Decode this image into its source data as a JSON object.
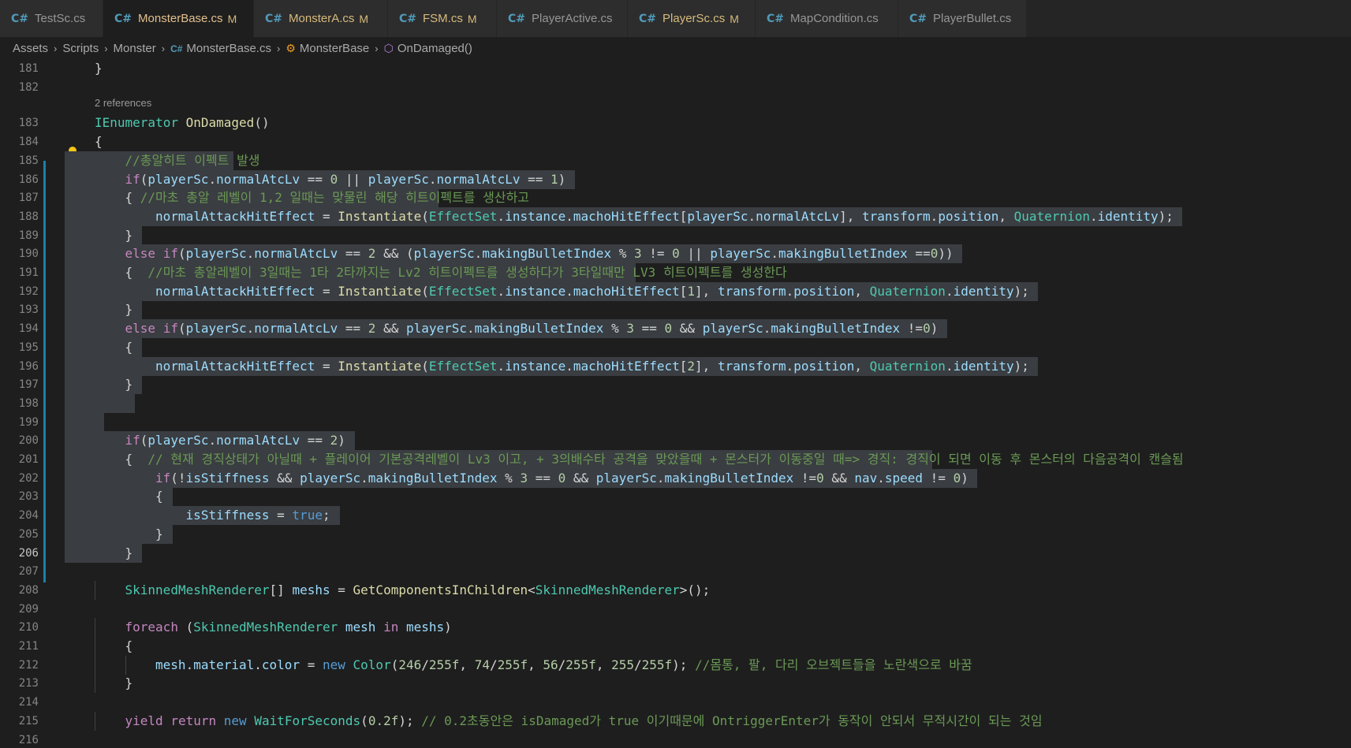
{
  "tabs": [
    {
      "label": "TestSc.cs",
      "status": "",
      "active": false,
      "dirty": false
    },
    {
      "label": "MonsterBase.cs",
      "status": "M",
      "active": true,
      "dirty": true
    },
    {
      "label": "MonsterA.cs",
      "status": "M",
      "active": false,
      "dirty": false
    },
    {
      "label": "FSM.cs",
      "status": "M",
      "active": false,
      "dirty": false
    },
    {
      "label": "PlayerActive.cs",
      "status": "",
      "active": false,
      "dirty": false
    },
    {
      "label": "PlayerSc.cs",
      "status": "M",
      "active": false,
      "dirty": false
    },
    {
      "label": "MapCondition.cs",
      "status": "",
      "active": false,
      "dirty": false
    },
    {
      "label": "PlayerBullet.cs",
      "status": "",
      "active": false,
      "dirty": false
    }
  ],
  "tab_icon_glyph": "C#",
  "breadcrumb": [
    {
      "label": "Assets",
      "icon": ""
    },
    {
      "label": "Scripts",
      "icon": ""
    },
    {
      "label": "Monster",
      "icon": ""
    },
    {
      "label": "MonsterBase.cs",
      "icon": "csharp-file-icon"
    },
    {
      "label": "MonsterBase",
      "icon": "class-icon"
    },
    {
      "label": "OnDamaged()",
      "icon": "method-icon"
    }
  ],
  "codelens": "2 references",
  "current_line": 206,
  "colors": {
    "background": "#1e1e1e",
    "tab_bar": "#252526",
    "selection": "#3a3d41",
    "keyword": "#569cd6",
    "control": "#c586c0",
    "type": "#4ec9b0",
    "function": "#dcdcaa",
    "variable": "#9cdcfe",
    "number": "#b5cea8",
    "comment": "#6a9955",
    "modified_bar": "#1b81a8"
  },
  "lines": [
    {
      "n": 181,
      "indent": 0,
      "sel": false,
      "tokens": [
        [
          "pl",
          "}"
        ]
      ]
    },
    {
      "n": 182,
      "indent": 0,
      "sel": false,
      "tokens": []
    },
    {
      "n": 183,
      "indent": 0,
      "sel": false,
      "tokens": [
        [
          "ty",
          "IEnumerator"
        ],
        [
          "pl",
          " "
        ],
        [
          "fn",
          "OnDamaged"
        ],
        [
          "pl",
          "()"
        ]
      ]
    },
    {
      "n": 184,
      "indent": 0,
      "sel": false,
      "tokens": [
        [
          "pl",
          "{"
        ]
      ]
    },
    {
      "n": 185,
      "indent": 1,
      "sel": true,
      "tokens": [
        [
          "cm",
          "//총알히트 이펙트 발생"
        ]
      ]
    },
    {
      "n": 186,
      "indent": 1,
      "sel": true,
      "tokens": [
        [
          "ctl",
          "if"
        ],
        [
          "pl",
          "("
        ],
        [
          "var",
          "playerSc"
        ],
        [
          "pl",
          "."
        ],
        [
          "var",
          "normalAtcLv"
        ],
        [
          "pl",
          " == "
        ],
        [
          "num",
          "0"
        ],
        [
          "pl",
          " || "
        ],
        [
          "var",
          "playerSc"
        ],
        [
          "pl",
          "."
        ],
        [
          "var",
          "normalAtcLv"
        ],
        [
          "pl",
          " == "
        ],
        [
          "num",
          "1"
        ],
        [
          "pl",
          ")"
        ]
      ]
    },
    {
      "n": 187,
      "indent": 1,
      "sel": true,
      "tokens": [
        [
          "pl",
          "{ "
        ],
        [
          "cm",
          "//마초 총알 레벨이 1,2 일때는 맞물린 해당 히트이펙트를 생산하고"
        ]
      ]
    },
    {
      "n": 188,
      "indent": 2,
      "sel": true,
      "tokens": [
        [
          "var",
          "normalAttackHitEffect"
        ],
        [
          "pl",
          " = "
        ],
        [
          "fn",
          "Instantiate"
        ],
        [
          "pl",
          "("
        ],
        [
          "ty",
          "EffectSet"
        ],
        [
          "pl",
          "."
        ],
        [
          "var",
          "instance"
        ],
        [
          "pl",
          "."
        ],
        [
          "var",
          "machoHitEffect"
        ],
        [
          "pl",
          "["
        ],
        [
          "var",
          "playerSc"
        ],
        [
          "pl",
          "."
        ],
        [
          "var",
          "normalAtcLv"
        ],
        [
          "pl",
          "], "
        ],
        [
          "var",
          "transform"
        ],
        [
          "pl",
          "."
        ],
        [
          "var",
          "position"
        ],
        [
          "pl",
          ", "
        ],
        [
          "ty",
          "Quaternion"
        ],
        [
          "pl",
          "."
        ],
        [
          "var",
          "identity"
        ],
        [
          "pl",
          ");"
        ]
      ]
    },
    {
      "n": 189,
      "indent": 1,
      "sel": true,
      "tokens": [
        [
          "pl",
          "}"
        ]
      ]
    },
    {
      "n": 190,
      "indent": 1,
      "sel": true,
      "tokens": [
        [
          "ctl",
          "else"
        ],
        [
          "pl",
          " "
        ],
        [
          "ctl",
          "if"
        ],
        [
          "pl",
          "("
        ],
        [
          "var",
          "playerSc"
        ],
        [
          "pl",
          "."
        ],
        [
          "var",
          "normalAtcLv"
        ],
        [
          "pl",
          " == "
        ],
        [
          "num",
          "2"
        ],
        [
          "pl",
          " && ("
        ],
        [
          "var",
          "playerSc"
        ],
        [
          "pl",
          "."
        ],
        [
          "var",
          "makingBulletIndex"
        ],
        [
          "pl",
          " % "
        ],
        [
          "num",
          "3"
        ],
        [
          "pl",
          " != "
        ],
        [
          "num",
          "0"
        ],
        [
          "pl",
          " || "
        ],
        [
          "var",
          "playerSc"
        ],
        [
          "pl",
          "."
        ],
        [
          "var",
          "makingBulletIndex"
        ],
        [
          "pl",
          " =="
        ],
        [
          "num",
          "0"
        ],
        [
          "pl",
          "))"
        ]
      ]
    },
    {
      "n": 191,
      "indent": 1,
      "sel": true,
      "tokens": [
        [
          "pl",
          "{  "
        ],
        [
          "cm",
          "//마초 총알레벨이 3일때는 1타 2타까지는 Lv2 히트이펙트를 생성하다가 3타일때만 LV3 히트이펙트를 생성한다"
        ]
      ]
    },
    {
      "n": 192,
      "indent": 2,
      "sel": true,
      "tokens": [
        [
          "var",
          "normalAttackHitEffect"
        ],
        [
          "pl",
          " = "
        ],
        [
          "fn",
          "Instantiate"
        ],
        [
          "pl",
          "("
        ],
        [
          "ty",
          "EffectSet"
        ],
        [
          "pl",
          "."
        ],
        [
          "var",
          "instance"
        ],
        [
          "pl",
          "."
        ],
        [
          "var",
          "machoHitEffect"
        ],
        [
          "pl",
          "["
        ],
        [
          "num",
          "1"
        ],
        [
          "pl",
          "], "
        ],
        [
          "var",
          "transform"
        ],
        [
          "pl",
          "."
        ],
        [
          "var",
          "position"
        ],
        [
          "pl",
          ", "
        ],
        [
          "ty",
          "Quaternion"
        ],
        [
          "pl",
          "."
        ],
        [
          "var",
          "identity"
        ],
        [
          "pl",
          ");"
        ]
      ]
    },
    {
      "n": 193,
      "indent": 1,
      "sel": true,
      "tokens": [
        [
          "pl",
          "}"
        ]
      ]
    },
    {
      "n": 194,
      "indent": 1,
      "sel": true,
      "tokens": [
        [
          "ctl",
          "else"
        ],
        [
          "pl",
          " "
        ],
        [
          "ctl",
          "if"
        ],
        [
          "pl",
          "("
        ],
        [
          "var",
          "playerSc"
        ],
        [
          "pl",
          "."
        ],
        [
          "var",
          "normalAtcLv"
        ],
        [
          "pl",
          " == "
        ],
        [
          "num",
          "2"
        ],
        [
          "pl",
          " && "
        ],
        [
          "var",
          "playerSc"
        ],
        [
          "pl",
          "."
        ],
        [
          "var",
          "makingBulletIndex"
        ],
        [
          "pl",
          " % "
        ],
        [
          "num",
          "3"
        ],
        [
          "pl",
          " == "
        ],
        [
          "num",
          "0"
        ],
        [
          "pl",
          " && "
        ],
        [
          "var",
          "playerSc"
        ],
        [
          "pl",
          "."
        ],
        [
          "var",
          "makingBulletIndex"
        ],
        [
          "pl",
          " !="
        ],
        [
          "num",
          "0"
        ],
        [
          "pl",
          ")"
        ]
      ]
    },
    {
      "n": 195,
      "indent": 1,
      "sel": true,
      "tokens": [
        [
          "pl",
          "{"
        ]
      ]
    },
    {
      "n": 196,
      "indent": 2,
      "sel": true,
      "tokens": [
        [
          "var",
          "normalAttackHitEffect"
        ],
        [
          "pl",
          " = "
        ],
        [
          "fn",
          "Instantiate"
        ],
        [
          "pl",
          "("
        ],
        [
          "ty",
          "EffectSet"
        ],
        [
          "pl",
          "."
        ],
        [
          "var",
          "instance"
        ],
        [
          "pl",
          "."
        ],
        [
          "var",
          "machoHitEffect"
        ],
        [
          "pl",
          "["
        ],
        [
          "num",
          "2"
        ],
        [
          "pl",
          "], "
        ],
        [
          "var",
          "transform"
        ],
        [
          "pl",
          "."
        ],
        [
          "var",
          "position"
        ],
        [
          "pl",
          ", "
        ],
        [
          "ty",
          "Quaternion"
        ],
        [
          "pl",
          "."
        ],
        [
          "var",
          "identity"
        ],
        [
          "pl",
          ");"
        ]
      ]
    },
    {
      "n": 197,
      "indent": 1,
      "sel": true,
      "tokens": [
        [
          "pl",
          "}"
        ]
      ]
    },
    {
      "n": 198,
      "indent": 1,
      "sel": true,
      "tokens": []
    },
    {
      "n": 199,
      "indent": 0,
      "sel": true,
      "tokens": []
    },
    {
      "n": 200,
      "indent": 1,
      "sel": true,
      "tokens": [
        [
          "ctl",
          "if"
        ],
        [
          "pl",
          "("
        ],
        [
          "var",
          "playerSc"
        ],
        [
          "pl",
          "."
        ],
        [
          "var",
          "normalAtcLv"
        ],
        [
          "pl",
          " == "
        ],
        [
          "num",
          "2"
        ],
        [
          "pl",
          ")"
        ]
      ]
    },
    {
      "n": 201,
      "indent": 1,
      "sel": true,
      "tokens": [
        [
          "pl",
          "{  "
        ],
        [
          "cm",
          "// 현재 경직상태가 아닐때 + 플레이어 기본공격레벨이 Lv3 이고, + 3의배수타 공격을 맞았을때 + 몬스터가 이동중일 때=> 경직: 경직이 되면 이동 후 몬스터의 다음공격이 캔슬됨"
        ]
      ]
    },
    {
      "n": 202,
      "indent": 2,
      "sel": true,
      "tokens": [
        [
          "ctl",
          "if"
        ],
        [
          "pl",
          "(!"
        ],
        [
          "var",
          "isStiffness"
        ],
        [
          "pl",
          " && "
        ],
        [
          "var",
          "playerSc"
        ],
        [
          "pl",
          "."
        ],
        [
          "var",
          "makingBulletIndex"
        ],
        [
          "pl",
          " % "
        ],
        [
          "num",
          "3"
        ],
        [
          "pl",
          " == "
        ],
        [
          "num",
          "0"
        ],
        [
          "pl",
          " && "
        ],
        [
          "var",
          "playerSc"
        ],
        [
          "pl",
          "."
        ],
        [
          "var",
          "makingBulletIndex"
        ],
        [
          "pl",
          " !="
        ],
        [
          "num",
          "0"
        ],
        [
          "pl",
          " && "
        ],
        [
          "var",
          "nav"
        ],
        [
          "pl",
          "."
        ],
        [
          "var",
          "speed"
        ],
        [
          "pl",
          " != "
        ],
        [
          "num",
          "0"
        ],
        [
          "pl",
          ")"
        ]
      ]
    },
    {
      "n": 203,
      "indent": 2,
      "sel": true,
      "tokens": [
        [
          "pl",
          "{"
        ]
      ]
    },
    {
      "n": 204,
      "indent": 3,
      "sel": true,
      "tokens": [
        [
          "var",
          "isStiffness"
        ],
        [
          "pl",
          " = "
        ],
        [
          "kw",
          "true"
        ],
        [
          "pl",
          ";"
        ]
      ]
    },
    {
      "n": 205,
      "indent": 2,
      "sel": true,
      "tokens": [
        [
          "pl",
          "}"
        ]
      ]
    },
    {
      "n": 206,
      "indent": 1,
      "sel": true,
      "tokens": [
        [
          "pl",
          "}"
        ]
      ]
    },
    {
      "n": 207,
      "indent": 0,
      "sel": false,
      "tokens": []
    },
    {
      "n": 208,
      "indent": 1,
      "sel": false,
      "tokens": [
        [
          "ty",
          "SkinnedMeshRenderer"
        ],
        [
          "pl",
          "[] "
        ],
        [
          "var",
          "meshs"
        ],
        [
          "pl",
          " = "
        ],
        [
          "fn",
          "GetComponentsInChildren"
        ],
        [
          "pl",
          "<"
        ],
        [
          "ty",
          "SkinnedMeshRenderer"
        ],
        [
          "pl",
          ">();"
        ]
      ]
    },
    {
      "n": 209,
      "indent": 0,
      "sel": false,
      "tokens": []
    },
    {
      "n": 210,
      "indent": 1,
      "sel": false,
      "tokens": [
        [
          "ctl",
          "foreach"
        ],
        [
          "pl",
          " ("
        ],
        [
          "ty",
          "SkinnedMeshRenderer"
        ],
        [
          "pl",
          " "
        ],
        [
          "var",
          "mesh"
        ],
        [
          "pl",
          " "
        ],
        [
          "ctl",
          "in"
        ],
        [
          "pl",
          " "
        ],
        [
          "var",
          "meshs"
        ],
        [
          "pl",
          ")"
        ]
      ]
    },
    {
      "n": 211,
      "indent": 1,
      "sel": false,
      "tokens": [
        [
          "pl",
          "{"
        ]
      ]
    },
    {
      "n": 212,
      "indent": 2,
      "sel": false,
      "tokens": [
        [
          "var",
          "mesh"
        ],
        [
          "pl",
          "."
        ],
        [
          "var",
          "material"
        ],
        [
          "pl",
          "."
        ],
        [
          "var",
          "color"
        ],
        [
          "pl",
          " = "
        ],
        [
          "kw",
          "new"
        ],
        [
          "pl",
          " "
        ],
        [
          "ty",
          "Color"
        ],
        [
          "pl",
          "("
        ],
        [
          "num",
          "246"
        ],
        [
          "pl",
          "/"
        ],
        [
          "num",
          "255f"
        ],
        [
          "pl",
          ", "
        ],
        [
          "num",
          "74"
        ],
        [
          "pl",
          "/"
        ],
        [
          "num",
          "255f"
        ],
        [
          "pl",
          ", "
        ],
        [
          "num",
          "56"
        ],
        [
          "pl",
          "/"
        ],
        [
          "num",
          "255f"
        ],
        [
          "pl",
          ", "
        ],
        [
          "num",
          "255"
        ],
        [
          "pl",
          "/"
        ],
        [
          "num",
          "255f"
        ],
        [
          "pl",
          "); "
        ],
        [
          "cm",
          "//몸통, 팔, 다리 오브젝트들을 노란색으로 바꿈"
        ]
      ]
    },
    {
      "n": 213,
      "indent": 1,
      "sel": false,
      "tokens": [
        [
          "pl",
          "}"
        ]
      ]
    },
    {
      "n": 214,
      "indent": 0,
      "sel": false,
      "tokens": []
    },
    {
      "n": 215,
      "indent": 1,
      "sel": false,
      "tokens": [
        [
          "ctl",
          "yield"
        ],
        [
          "pl",
          " "
        ],
        [
          "ctl",
          "return"
        ],
        [
          "pl",
          " "
        ],
        [
          "kw",
          "new"
        ],
        [
          "pl",
          " "
        ],
        [
          "ty",
          "WaitForSeconds"
        ],
        [
          "pl",
          "("
        ],
        [
          "num",
          "0.2f"
        ],
        [
          "pl",
          "); "
        ],
        [
          "cm",
          "// 0.2초동안은 isDamaged가 true 이기때문에 OntriggerEnter가 동작이 안되서 무적시간이 되는 것임"
        ]
      ]
    },
    {
      "n": 216,
      "indent": 0,
      "sel": false,
      "tokens": []
    }
  ]
}
